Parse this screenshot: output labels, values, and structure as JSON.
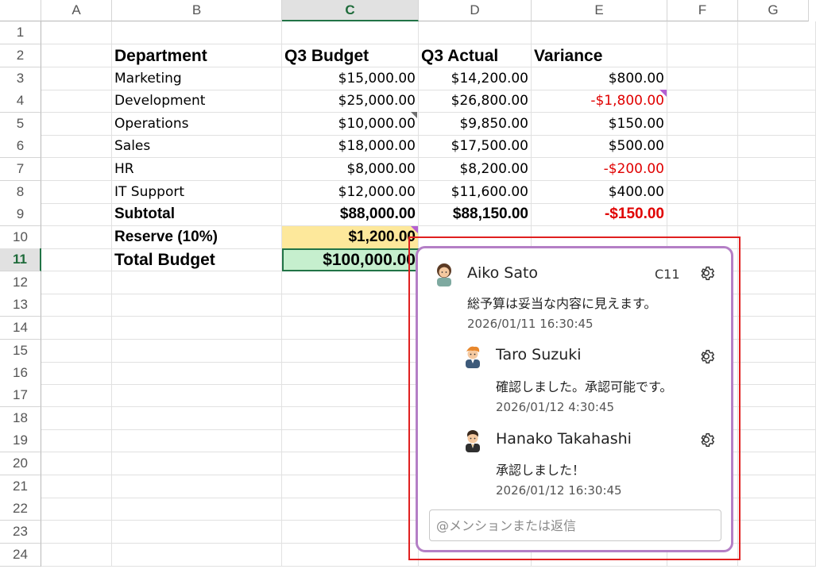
{
  "columns": [
    "A",
    "B",
    "C",
    "D",
    "E",
    "F",
    "G"
  ],
  "active_column": "C",
  "rows": [
    "1",
    "2",
    "3",
    "4",
    "5",
    "6",
    "7",
    "8",
    "9",
    "10",
    "11",
    "12",
    "13",
    "14",
    "15",
    "16",
    "17",
    "18",
    "19",
    "20",
    "21",
    "22",
    "23",
    "24"
  ],
  "active_row": "11",
  "table": {
    "headers": [
      "Department",
      "Q3 Budget",
      "Q3 Actual",
      "Variance"
    ],
    "data": [
      {
        "department": "Marketing",
        "budget": "$15,000.00",
        "actual": "$14,200.00",
        "variance": "$800.00"
      },
      {
        "department": "Development",
        "budget": "$25,000.00",
        "actual": "$26,800.00",
        "variance": "-$1,800.00"
      },
      {
        "department": "Operations",
        "budget": "$10,000.00",
        "actual": "$9,850.00",
        "variance": "$150.00"
      },
      {
        "department": "Sales",
        "budget": "$18,000.00",
        "actual": "$17,500.00",
        "variance": "$500.00"
      },
      {
        "department": "HR",
        "budget": "$8,000.00",
        "actual": "$8,200.00",
        "variance": "-$200.00"
      },
      {
        "department": "IT Support",
        "budget": "$12,000.00",
        "actual": "$11,600.00",
        "variance": "$400.00"
      }
    ],
    "subtotal": {
      "label": "Subtotal",
      "budget": "$88,000.00",
      "actual": "$88,150.00",
      "variance": "-$150.00"
    },
    "reserve": {
      "label": "Reserve (10%)",
      "budget": "$1,200.00"
    },
    "total": {
      "label": "Total Budget",
      "budget": "$100,000.00"
    }
  },
  "colors": {
    "negative": "#e00000",
    "reserve_fill": "#fde89b",
    "total_fill": "#c6efce",
    "selection": "#217346",
    "comment_border": "#b47fc6",
    "highlight_box": "#e02020"
  },
  "comment_thread": {
    "cell_ref": "C11",
    "comments": [
      {
        "author": "Aiko Sato",
        "text": "総予算は妥当な内容に見えます。",
        "timestamp": "2026/01/11 16:30:45",
        "avatar_icon": "avatar-woman-icon"
      },
      {
        "author": "Taro Suzuki",
        "text": "確認しました。承認可能です。",
        "timestamp": "2026/01/12 4:30:45",
        "avatar_icon": "avatar-man-orange-hair-icon"
      },
      {
        "author": "Hanako Takahashi",
        "text": "承認しました！",
        "timestamp": "2026/01/12 16:30:45",
        "avatar_icon": "avatar-man-suit-icon"
      }
    ],
    "settings_icon": "gear-icon",
    "reply_placeholder": "@メンションまたは返信"
  }
}
